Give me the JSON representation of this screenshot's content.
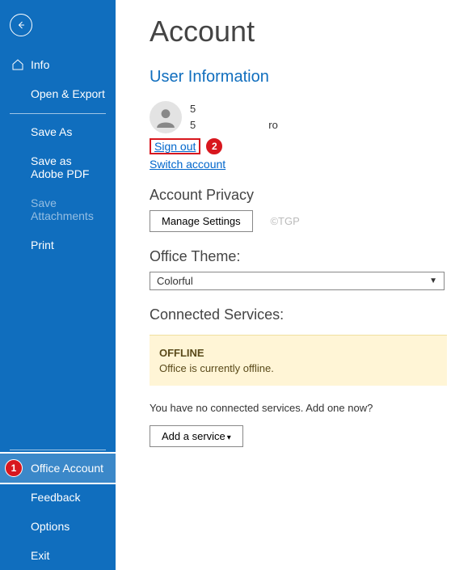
{
  "sidebar": {
    "info": "Info",
    "open_export": "Open & Export",
    "save_as": "Save As",
    "save_adobe": "Save as Adobe PDF",
    "save_attachments": "Save Attachments",
    "print": "Print",
    "office_account": "Office Account",
    "feedback": "Feedback",
    "options": "Options",
    "exit": "Exit"
  },
  "annotations": {
    "badge1": "1",
    "badge2": "2"
  },
  "content": {
    "page_title": "Account",
    "user_info_header": "User Information",
    "user_line1_prefix": "5",
    "user_line2_prefix": "5",
    "user_line2_suffix": "ro",
    "sign_out": "Sign out",
    "switch_account": "Switch account",
    "account_privacy_header": "Account Privacy",
    "manage_settings": "Manage Settings",
    "watermark": "©TGP",
    "office_theme_header": "Office Theme:",
    "office_theme_value": "Colorful",
    "connected_services_header": "Connected Services:",
    "offline_title": "OFFLINE",
    "offline_message": "Office is currently offline.",
    "no_services_text": "You have no connected services. Add one now?",
    "add_service": "Add a service"
  }
}
